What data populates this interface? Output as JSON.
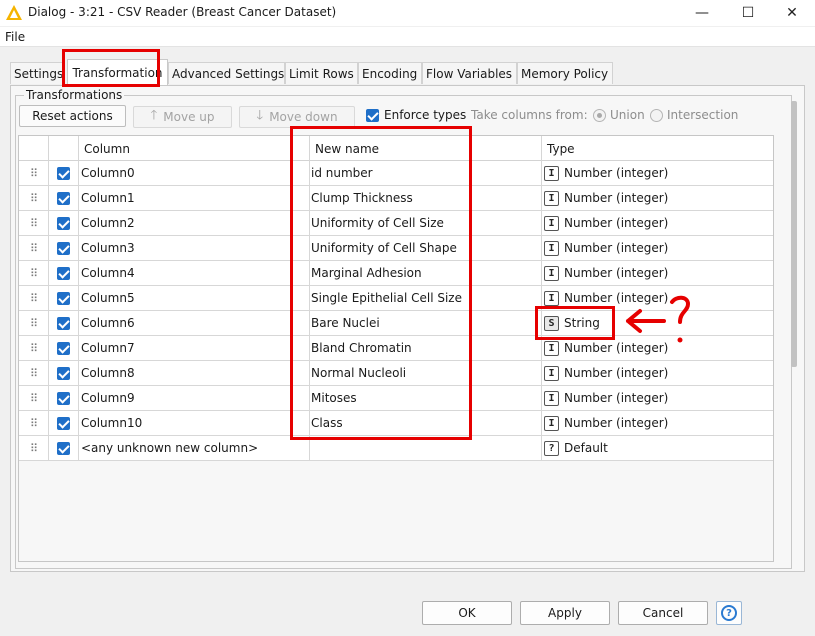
{
  "window": {
    "title": "Dialog - 3:21 - CSV Reader (Breast Cancer Dataset)",
    "minimize_glyph": "—",
    "maximize_glyph": "☐",
    "close_glyph": "✕"
  },
  "menu": {
    "file": "File"
  },
  "tabs": [
    {
      "label": "Settings"
    },
    {
      "label": "Transformation",
      "active": true
    },
    {
      "label": "Advanced Settings"
    },
    {
      "label": "Limit Rows"
    },
    {
      "label": "Encoding"
    },
    {
      "label": "Flow Variables"
    },
    {
      "label": "Memory Policy"
    }
  ],
  "transformations": {
    "group_title": "Transformations",
    "reset_label": "Reset actions",
    "move_up_label": "Move up",
    "move_down_label": "Move down",
    "enforce_types_label": "Enforce types",
    "enforce_types_checked": true,
    "take_columns_label": "Take columns from:",
    "union_label": "Union",
    "intersection_label": "Intersection",
    "selected_source": "Union"
  },
  "table": {
    "headers": {
      "column": "Column",
      "new_name": "New name",
      "type": "Type"
    },
    "rows": [
      {
        "column": "Column0",
        "new_name": "id number",
        "type": "Number (integer)",
        "type_icon": "I"
      },
      {
        "column": "Column1",
        "new_name": "Clump Thickness",
        "type": "Number (integer)",
        "type_icon": "I"
      },
      {
        "column": "Column2",
        "new_name": "Uniformity of Cell Size",
        "type": "Number (integer)",
        "type_icon": "I"
      },
      {
        "column": "Column3",
        "new_name": "Uniformity of Cell Shape",
        "type": "Number (integer)",
        "type_icon": "I"
      },
      {
        "column": "Column4",
        "new_name": "Marginal Adhesion",
        "type": "Number (integer)",
        "type_icon": "I"
      },
      {
        "column": "Column5",
        "new_name": "Single Epithelial Cell Size",
        "type": "Number (integer)",
        "type_icon": "I"
      },
      {
        "column": "Column6",
        "new_name": "Bare Nuclei",
        "type": "String",
        "type_icon": "S"
      },
      {
        "column": "Column7",
        "new_name": "Bland Chromatin",
        "type": "Number (integer)",
        "type_icon": "I"
      },
      {
        "column": "Column8",
        "new_name": "Normal Nucleoli",
        "type": "Number (integer)",
        "type_icon": "I"
      },
      {
        "column": "Column9",
        "new_name": "Mitoses",
        "type": "Number (integer)",
        "type_icon": "I"
      },
      {
        "column": "Column10",
        "new_name": "Class",
        "type": "Number (integer)",
        "type_icon": "I"
      },
      {
        "column": "<any unknown new column>",
        "new_name": "",
        "type": "Default",
        "type_icon": "?"
      }
    ]
  },
  "buttons": {
    "ok": "OK",
    "apply": "Apply",
    "cancel": "Cancel",
    "help": "?"
  },
  "annotation": {
    "question_mark": "?"
  },
  "colors": {
    "annotation_red": "#e60000",
    "checkbox_blue": "#1f6fc8"
  }
}
